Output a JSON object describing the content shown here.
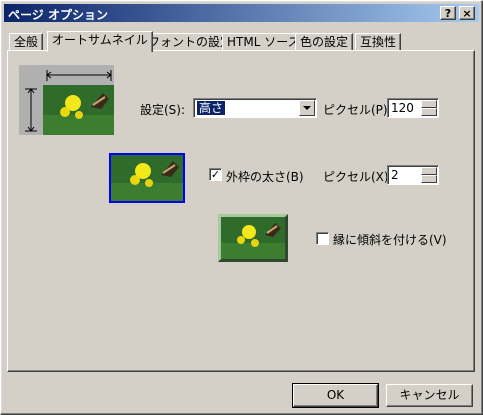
{
  "window": {
    "title": "ページ オプション",
    "help_button": "?",
    "close_button": "×"
  },
  "tabs": [
    {
      "label": "全般",
      "active": false
    },
    {
      "label": "オートサムネイル",
      "active": true
    },
    {
      "label": "フォントの設定",
      "active": false
    },
    {
      "label": "HTML ソース",
      "active": false
    },
    {
      "label": "色の設定",
      "active": false
    },
    {
      "label": "互換性",
      "active": false
    }
  ],
  "size": {
    "label": "設定(S):",
    "selected": "高さ",
    "pixel_label": "ピクセル(P):",
    "pixel_value": "120"
  },
  "border": {
    "label": "外枠の太さ(B)",
    "checked": true,
    "pixel_label": "ピクセル(X):",
    "pixel_value": "2"
  },
  "bevel": {
    "label": "縁に傾斜を付ける(V)",
    "checked": false
  },
  "buttons": {
    "ok": "OK",
    "cancel": "キャンセル"
  },
  "colors": {
    "titlebar_start": "#0a246a",
    "titlebar_end": "#a6caf0",
    "face": "#d4d0c8",
    "border_highlight": "#0000ff"
  }
}
